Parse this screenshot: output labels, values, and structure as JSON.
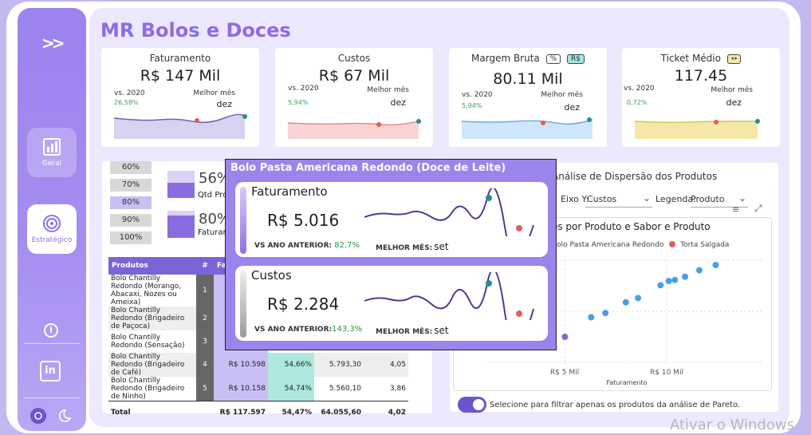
{
  "app": {
    "title": "MR Bolos e Doces"
  },
  "sidebar": {
    "items": [
      {
        "label": "Geral",
        "icon": "report-icon"
      },
      {
        "label": "Estratégico",
        "icon": "target-icon"
      }
    ]
  },
  "kpis": [
    {
      "title": "Faturamento",
      "value": "R$ 147 Mil",
      "vs_label": "vs. 2020",
      "vs_value": "26,58%",
      "best_label": "Melhor mês",
      "best_value": "dez",
      "color": "#b8b3e0"
    },
    {
      "title": "Custos",
      "value": "R$ 67 Mil",
      "vs_label": "vs. 2020",
      "vs_value": "5,94%",
      "best_label": "Melhor mês",
      "best_value": "dez",
      "color": "#f6c7c7"
    },
    {
      "title": "Margem Bruta",
      "value": "80.11 Mil",
      "vs_label": "vs. 2020",
      "vs_value": "5,94%",
      "best_label": "Melhor mês",
      "best_value": "dez",
      "color": "#bfe0fb",
      "tags": [
        "%",
        "R$"
      ]
    },
    {
      "title": "Ticket Médio",
      "value": "117.45",
      "vs_label": "vs. 2020",
      "vs_value": "0,72%",
      "best_label": "Melhor mês",
      "best_value": "dez",
      "color": "#f5e8a8",
      "tags": [
        "↔"
      ]
    }
  ],
  "pareto": {
    "buttons": [
      "60%",
      "70%",
      "80%",
      "90%",
      "100%"
    ],
    "selected": "80%",
    "qtd_pct": "56%",
    "qtd_label": "Qtd Pro",
    "fat_pct": "80%",
    "fat_label": "Faturam"
  },
  "table": {
    "headers": [
      "Produtos",
      "#",
      "Fat"
    ],
    "rows": [
      {
        "name": "Bolo Chantilly Redondo (Morango, Abacaxi, Nozes ou Ameixa)",
        "n": "1",
        "fat": "",
        "mg": "",
        "cost": "",
        "tm": ""
      },
      {
        "name": "Bolo Chantilly Redondo (Brigadeiro de Paçoca)",
        "n": "2",
        "fat": "",
        "mg": "",
        "cost": "",
        "tm": ""
      },
      {
        "name": "Bolo Chantilly Redondo (Sensação)",
        "n": "3",
        "fat": "",
        "mg": "",
        "cost": "",
        "tm": ""
      },
      {
        "name": "Bolo Chantilly Redondo (Brigadeiro de Café)",
        "n": "4",
        "fat": "R$ 10.598",
        "mg": "54,66%",
        "cost": "5.793,30",
        "tm": "4,05"
      },
      {
        "name": "Bolo Chantilly Redondo (Brigadeiro de Ninho)",
        "n": "5",
        "fat": "R$ 10.158",
        "mg": "54,74%",
        "cost": "5.560,10",
        "tm": "3,86"
      }
    ],
    "total": {
      "label": "Total",
      "fat": "R$ 117.597",
      "mg": "54,47%",
      "cost": "64.055,60",
      "tm": "4,02"
    }
  },
  "dispersion": {
    "title": "Análise de Dispersão dos Produtos",
    "axis_y_label": "Eixo Y:",
    "axis_y_value": "Custos",
    "legend_label": "Legenda:",
    "legend_value": "Produto",
    "chart_title": "os por Produto e Sabor e Produto",
    "legend_items": [
      "Bolo Pasta Americana Redondo",
      "Torta Salgada"
    ],
    "xlabel": "Faturamento",
    "xticks": [
      "R$ 5 Mil",
      "R$ 10 Mil"
    ],
    "toggle_label": "Selecione para filtrar apenas os produtos da análise de Pareto."
  },
  "chart_data": {
    "type": "scatter",
    "title": "",
    "xlabel": "Faturamento",
    "ylabel": "Custos",
    "series": [
      {
        "name": "Bolo Pasta Americana Redondo",
        "color": "#7b70c7",
        "points": [
          [
            5016,
            2284
          ]
        ]
      },
      {
        "name": "",
        "color": "#4a9ee8",
        "points": [
          [
            6300,
            3200
          ],
          [
            7000,
            3400
          ],
          [
            8000,
            3900
          ],
          [
            8600,
            4100
          ],
          [
            9700,
            4700
          ],
          [
            10100,
            4900
          ],
          [
            10400,
            4950
          ],
          [
            10900,
            5100
          ],
          [
            11600,
            5400
          ],
          [
            12400,
            5650
          ]
        ]
      }
    ],
    "xlim": [
      3000,
      13500
    ]
  },
  "tooltip": {
    "title": "Bolo Pasta Americana Redondo (Doce de Leite)",
    "cards": [
      {
        "label": "Faturamento",
        "value": "R$ 5.016",
        "vs_label": "VS ANO ANTERIOR:",
        "vs_value": "82,7%",
        "best_label": "MELHOR MÊS:",
        "best_value": "set"
      },
      {
        "label": "Custos",
        "value": "R$ 2.284",
        "vs_label": "VS ANO ANTERIOR:",
        "vs_value": "143,3%",
        "best_label": "MELHOR MÊS:",
        "best_value": "set"
      }
    ]
  },
  "watermark": "Ativar o Windows"
}
